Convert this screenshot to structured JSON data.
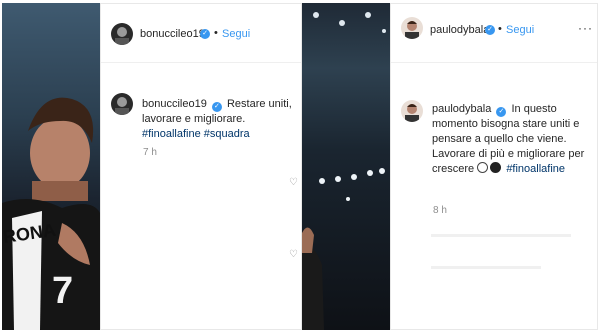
{
  "post1": {
    "username": "bonucci­leo19",
    "follow_label": "Segui",
    "comment_username": "bonucci­leo19",
    "caption_text": "Restare uniti, lavorare e migliorare.",
    "hashtag1": "#finoallafine",
    "hashtag2": "#squadra",
    "time": "7 h"
  },
  "post2": {
    "username": "paulodybala",
    "follow_label": "Segui",
    "comment_username": "paulodybala",
    "caption_text": "In questo momento bisogna stare uniti e pensare a quello che viene. Lavorare di più e migliorare per crescere",
    "hashtag": "#finoallafine",
    "time": "8 h"
  },
  "colors": {
    "verified": "#3897f0",
    "follow": "#3897f0",
    "hashtag": "#003569",
    "time": "#8e8e8e"
  },
  "icons": {
    "verified": "verified-badge-icon",
    "more": "more-options-icon",
    "heart": "heart-icon"
  }
}
